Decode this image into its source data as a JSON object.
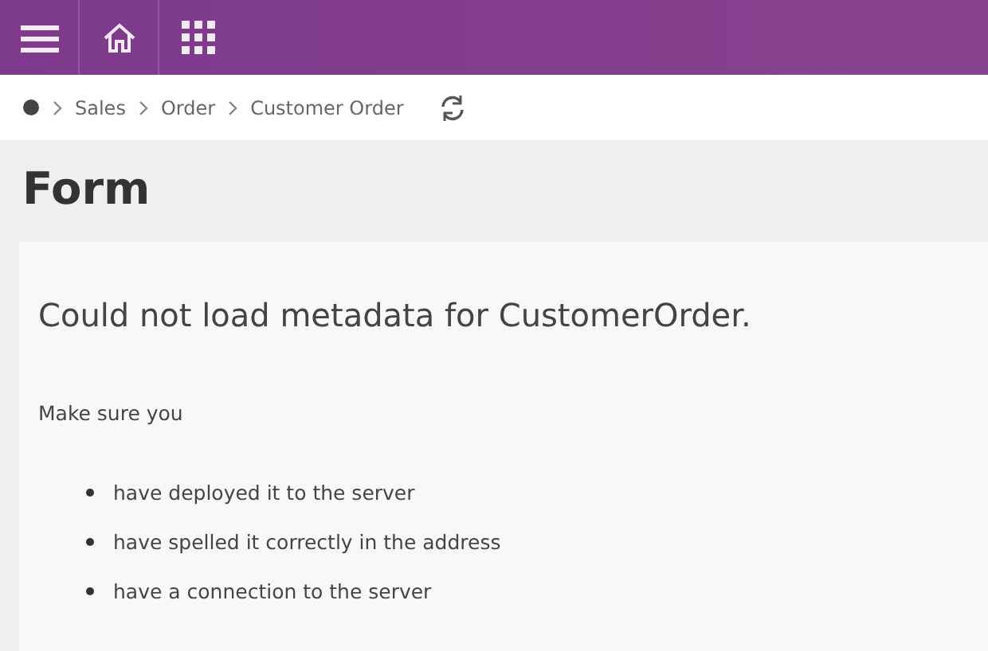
{
  "breadcrumb": [
    "Sales",
    "Order",
    "Customer Order"
  ],
  "page_title": "Form",
  "error": {
    "heading": "Could not load metadata for CustomerOrder.",
    "intro": "Make sure you",
    "items": [
      "have deployed it to the server",
      "have spelled it correctly in the address",
      "have a connection to the server"
    ]
  }
}
